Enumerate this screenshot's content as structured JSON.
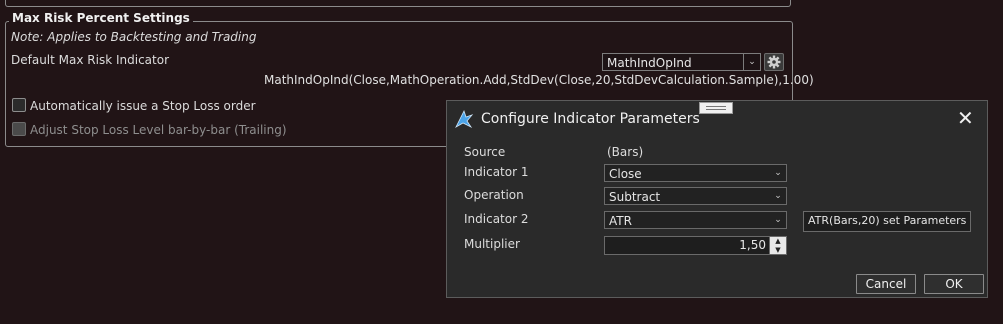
{
  "settings": {
    "group_title": "Max Risk Percent Settings",
    "note": "Note: Applies to Backtesting and Trading",
    "default_indicator_label": "Default Max Risk Indicator",
    "default_indicator_value": "MathIndOpInd",
    "formula": "MathIndOpInd(Close,MathOperation.Add,StdDev(Close,20,StdDevCalculation.Sample),1.00)",
    "stop_loss_label": "Automatically issue a Stop Loss order",
    "trailing_label": "Adjust Stop Loss Level bar-by-bar (Trailing)"
  },
  "dialog": {
    "title": "Configure Indicator Parameters",
    "close_glyph": "✕",
    "params": {
      "source_label": "Source",
      "source_value": "(Bars)",
      "indicator1_label": "Indicator 1",
      "indicator1_value": "Close",
      "operation_label": "Operation",
      "operation_value": "Subtract",
      "indicator2_label": "Indicator 2",
      "indicator2_value": "ATR",
      "indicator2_params": "ATR(Bars,20) set Parameters ...",
      "multiplier_label": "Multiplier",
      "multiplier_value": "1,50"
    },
    "buttons": {
      "cancel": "Cancel",
      "ok": "OK"
    }
  },
  "icons": {
    "dropdown": "chevron-down-icon",
    "gear": "gear-icon",
    "close": "close-icon",
    "app": "indicator-app-icon"
  },
  "colors": {
    "background": "#211416",
    "dialog_bg": "#2a2a2a",
    "accent_icon": "#4aa3e8"
  }
}
